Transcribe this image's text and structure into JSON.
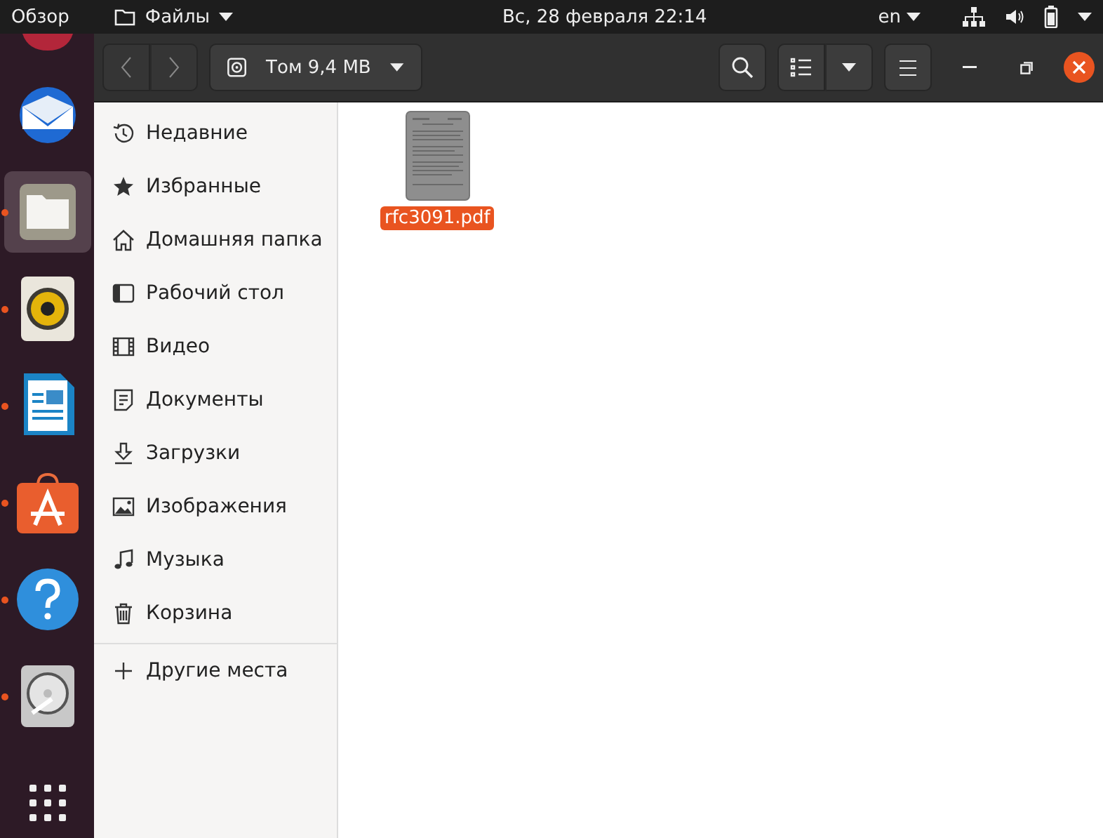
{
  "top_bar": {
    "activities": "Обзор",
    "app_menu": "Файлы",
    "clock": "Вс, 28 февраля  22:14",
    "keyboard_layout": "en"
  },
  "dock": [
    {
      "kind": "mail",
      "running": false,
      "selected": false
    },
    {
      "kind": "files",
      "running": true,
      "selected": true
    },
    {
      "kind": "speaker",
      "running": true,
      "selected": false
    },
    {
      "kind": "writer",
      "running": true,
      "selected": false
    },
    {
      "kind": "store",
      "running": true,
      "selected": false
    },
    {
      "kind": "help",
      "running": true,
      "selected": false
    },
    {
      "kind": "disk",
      "running": true,
      "selected": false
    }
  ],
  "header": {
    "location": "Том 9,4 MB"
  },
  "sidebar": {
    "items": [
      {
        "label": "Недавние",
        "kind": "recent"
      },
      {
        "label": "Избранные",
        "kind": "starred"
      },
      {
        "label": "Домашняя папка",
        "kind": "home"
      },
      {
        "label": "Рабочий стол",
        "kind": "desktop"
      },
      {
        "label": "Видео",
        "kind": "videos"
      },
      {
        "label": "Документы",
        "kind": "documents"
      },
      {
        "label": "Загрузки",
        "kind": "downloads"
      },
      {
        "label": "Изображения",
        "kind": "pictures"
      },
      {
        "label": "Музыка",
        "kind": "music"
      },
      {
        "label": "Корзина",
        "kind": "trash"
      }
    ],
    "other": "Другие места"
  },
  "files": [
    {
      "name": "rfc3091.pdf",
      "selected": true
    }
  ]
}
